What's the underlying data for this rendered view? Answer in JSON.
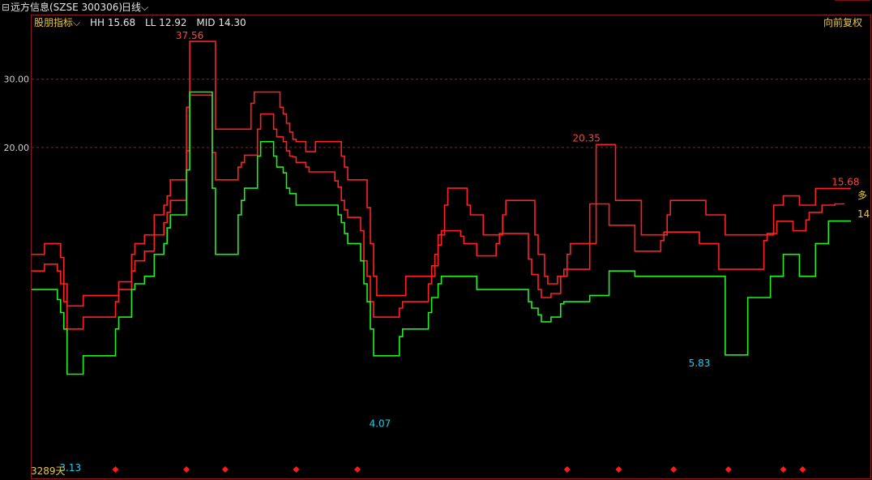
{
  "header": {
    "icon": "minus-box-icon",
    "stock_name": "远方信息(SZSE 300306)",
    "period": "日线",
    "period_icon": "chevron-down-icon"
  },
  "indicator": {
    "name": "股朋指标",
    "name_icon": "chevron-down-icon",
    "hh": "HH 15.68",
    "ll": "LL 12.92",
    "mid": "MID 14.30"
  },
  "adjust_label": "向前复权",
  "colors": {
    "hh": "#ff2020",
    "mid": "#ff2020",
    "ll": "#22ee22",
    "grid": "#a01818",
    "max_label": "#ff4040",
    "min_label": "#22ccee",
    "days_label": "#e8c84a",
    "marker": "#ff1a1a"
  },
  "chart_data": {
    "type": "line",
    "title": "",
    "xlabel": "",
    "ylabel": "",
    "ylim": [
      2.8,
      40
    ],
    "yticks": [
      "30.00",
      "20.00"
    ],
    "ytick_values": [
      30,
      20
    ],
    "grid": "horizontal dashed",
    "x": [
      0,
      1,
      2,
      3,
      4,
      5,
      6,
      7,
      8,
      9,
      10,
      11,
      12,
      13,
      14,
      15,
      16,
      17,
      18,
      19,
      20,
      21,
      22,
      23,
      24,
      25,
      26,
      27,
      28,
      29,
      30,
      31,
      32,
      33,
      34,
      35,
      36,
      37,
      38,
      39,
      40,
      41,
      42,
      43,
      44,
      45,
      46,
      47,
      48,
      49,
      50,
      51,
      52,
      53,
      54,
      55,
      56,
      57,
      58,
      59,
      60,
      61,
      62,
      63,
      64,
      65,
      66,
      67,
      68,
      69,
      70,
      71,
      72,
      73,
      74,
      75,
      76,
      77,
      78,
      79,
      80,
      81,
      82,
      83,
      84,
      85,
      86,
      87,
      88,
      89,
      90,
      91,
      92,
      93,
      94,
      95,
      96,
      97,
      98,
      99,
      100,
      101,
      102,
      103,
      104,
      105,
      106,
      107,
      108,
      109,
      110,
      111,
      112,
      113,
      114,
      115,
      116,
      117,
      118,
      119,
      120,
      121,
      122,
      123,
      124,
      125,
      126,
      127,
      128,
      129,
      130,
      131,
      132,
      133,
      134,
      135,
      136,
      137,
      138,
      139,
      140,
      141,
      142,
      143,
      144,
      145,
      146,
      147,
      148,
      149,
      150,
      151,
      152,
      153,
      154,
      155,
      156,
      157,
      158,
      159,
      160,
      161,
      162,
      163,
      164,
      165,
      166,
      167,
      168,
      169,
      170,
      171,
      172,
      173,
      174,
      175,
      176,
      177,
      178,
      179,
      180,
      181,
      182,
      183,
      184,
      185,
      186,
      187,
      188,
      189,
      190,
      191,
      192,
      193,
      194,
      195,
      196,
      197,
      198,
      199,
      200,
      201,
      202,
      203,
      204,
      205,
      206,
      207,
      208,
      209,
      210,
      211,
      212,
      213,
      214,
      215,
      216,
      217,
      218,
      219,
      220,
      221,
      222,
      223,
      224,
      225,
      226,
      227,
      228,
      229,
      230,
      231,
      232,
      233,
      234,
      235,
      236,
      237,
      238,
      239,
      240,
      241,
      242,
      243,
      244,
      245,
      246,
      247,
      248,
      249,
      250,
      251,
      252,
      253,
      254,
      255,
      256,
      257,
      258,
      259,
      260
    ],
    "series": [
      {
        "key": "hh",
        "values": [
          10.6,
          10.6,
          10.6,
          10.6,
          11.3,
          11.3,
          11.3,
          11.3,
          11.3,
          10.4,
          8.9,
          7.8,
          7.8,
          7.8,
          7.8,
          7.8,
          8.3,
          8.3,
          8.3,
          8.3,
          8.3,
          8.3,
          8.3,
          8.3,
          8.3,
          8.3,
          8.3,
          9.0,
          9.0,
          9.0,
          9.0,
          10.6,
          11.3,
          11.3,
          11.3,
          11.9,
          11.9,
          11.9,
          13.4,
          13.4,
          13.4,
          14.2,
          15.0,
          16.5,
          16.5,
          16.5,
          16.5,
          16.5,
          25.4,
          37.56,
          37.56,
          37.56,
          37.56,
          37.56,
          37.56,
          37.56,
          37.56,
          22.3,
          22.3,
          22.3,
          22.3,
          22.3,
          22.3,
          22.3,
          22.3,
          22.3,
          22.3,
          22.3,
          26.0,
          27.8,
          27.8,
          27.8,
          27.8,
          27.8,
          27.8,
          27.8,
          27.8,
          25.4,
          24.4,
          23.1,
          21.9,
          21.0,
          20.7,
          20.7,
          20.7,
          19.5,
          19.5,
          19.5,
          20.7,
          20.7,
          20.7,
          20.7,
          20.7,
          20.7,
          20.7,
          20.7,
          19.0,
          17.8,
          16.5,
          16.5,
          16.5,
          16.5,
          16.5,
          16.5,
          14.0,
          11.3,
          9.3,
          8.3,
          8.3,
          8.3,
          8.3,
          8.3,
          8.3,
          8.3,
          8.3,
          8.3,
          9.3,
          9.3,
          9.3,
          9.3,
          9.3,
          9.3,
          9.3,
          9.3,
          9.3,
          10.6,
          11.9,
          11.9,
          14.2,
          15.7,
          15.7,
          15.7,
          15.7,
          15.7,
          15.7,
          14.2,
          13.4,
          13.4,
          13.4,
          13.4,
          11.9,
          11.9,
          11.9,
          11.9,
          11.9,
          11.9,
          13.4,
          14.6,
          14.6,
          14.6,
          14.6,
          14.6,
          14.6,
          14.6,
          14.6,
          14.6,
          11.9,
          10.6,
          10.6,
          9.3,
          8.9,
          8.9,
          8.9,
          9.3,
          9.3,
          9.3,
          10.6,
          11.3,
          11.3,
          11.3,
          11.3,
          11.3,
          11.3,
          11.3,
          11.3,
          20.35,
          20.35,
          20.35,
          20.35,
          20.35,
          20.35,
          14.6,
          14.6,
          14.6,
          14.6,
          14.6,
          14.6,
          14.6,
          14.6,
          11.9,
          11.9,
          11.9,
          11.9,
          11.9,
          11.9,
          11.9,
          11.9,
          13.4,
          14.6,
          14.6,
          14.6,
          14.6,
          14.6,
          14.6,
          14.6,
          14.6,
          14.6,
          14.6,
          14.6,
          13.4,
          13.4,
          13.4,
          13.4,
          13.4,
          13.4,
          11.9,
          11.9,
          11.9,
          11.9,
          11.9,
          11.9,
          11.9,
          11.9,
          11.9,
          11.9,
          11.9,
          11.9,
          11.9,
          11.9,
          11.9,
          14.2,
          14.2,
          14.2,
          15.0,
          15.0,
          15.0,
          15.0,
          15.0,
          14.2,
          14.2,
          14.2,
          14.2,
          14.2,
          15.68,
          15.68,
          15.68,
          15.68,
          15.68,
          15.68,
          15.68,
          15.68,
          15.68,
          15.68,
          15.68,
          15.68
        ]
      },
      {
        "key": "mid",
        "values": [
          9.6,
          9.6,
          9.6,
          9.6,
          10.0,
          10.0,
          10.0,
          10.0,
          9.6,
          8.9,
          8.0,
          6.8,
          6.8,
          6.8,
          6.8,
          6.8,
          7.3,
          7.3,
          7.3,
          7.3,
          7.3,
          7.3,
          7.3,
          7.3,
          7.3,
          7.3,
          8.0,
          8.6,
          8.6,
          8.6,
          8.6,
          9.6,
          10.2,
          10.2,
          10.2,
          10.8,
          10.8,
          10.8,
          11.9,
          11.9,
          11.9,
          12.8,
          13.6,
          14.6,
          14.6,
          14.6,
          14.6,
          14.6,
          19.6,
          27.3,
          27.3,
          27.3,
          27.3,
          27.3,
          27.3,
          27.3,
          19.4,
          16.5,
          16.5,
          16.5,
          16.5,
          16.5,
          16.5,
          16.5,
          17.8,
          18.3,
          19.1,
          19.1,
          19.1,
          19.1,
          22.3,
          24.4,
          24.4,
          24.4,
          24.4,
          22.3,
          21.3,
          21.3,
          20.7,
          19.6,
          19.0,
          18.9,
          18.3,
          18.3,
          18.3,
          17.8,
          17.3,
          17.3,
          17.3,
          17.3,
          17.3,
          17.3,
          17.3,
          17.3,
          16.4,
          15.8,
          14.6,
          13.8,
          13.2,
          13.2,
          13.2,
          13.2,
          12.2,
          10.2,
          9.3,
          8.0,
          7.3,
          7.3,
          7.3,
          7.3,
          7.3,
          7.3,
          7.3,
          7.3,
          7.7,
          8.0,
          8.0,
          8.0,
          8.0,
          8.0,
          8.0,
          8.0,
          8.0,
          8.9,
          9.9,
          9.9,
          11.2,
          12.2,
          12.2,
          12.2,
          12.2,
          12.2,
          12.2,
          11.8,
          11.3,
          11.3,
          11.3,
          11.3,
          10.5,
          10.5,
          10.5,
          10.5,
          10.5,
          10.5,
          11.3,
          12.0,
          12.0,
          12.0,
          12.0,
          12.0,
          12.0,
          12.0,
          12.0,
          12.0,
          10.3,
          9.4,
          9.4,
          8.6,
          8.2,
          8.2,
          8.2,
          8.4,
          8.4,
          8.4,
          9.3,
          9.7,
          9.7,
          9.7,
          9.7,
          9.7,
          9.7,
          9.7,
          9.7,
          14.3,
          14.3,
          14.3,
          14.3,
          14.3,
          14.3,
          12.6,
          12.6,
          12.6,
          12.6,
          12.6,
          12.6,
          12.6,
          12.6,
          10.8,
          10.8,
          10.8,
          10.8,
          10.8,
          10.8,
          10.8,
          10.8,
          11.5,
          12.1,
          12.1,
          12.1,
          12.1,
          12.1,
          12.1,
          12.1,
          12.1,
          12.1,
          12.1,
          12.1,
          11.3,
          11.3,
          11.3,
          11.3,
          11.3,
          11.3,
          9.7,
          9.7,
          9.7,
          9.7,
          9.7,
          9.7,
          9.7,
          9.7,
          9.7,
          9.7,
          9.7,
          9.7,
          9.7,
          9.7,
          11.5,
          12.0,
          12.0,
          12.0,
          12.9,
          12.9,
          12.9,
          12.9,
          12.9,
          12.2,
          12.2,
          12.2,
          12.2,
          13.0,
          13.6,
          13.6,
          13.6,
          13.6,
          14.2,
          14.2,
          14.2,
          14.2,
          14.3,
          14.3,
          14.3,
          14.3
        ]
      },
      {
        "key": "ll",
        "values": [
          8.6,
          8.6,
          8.6,
          8.6,
          8.6,
          8.6,
          8.6,
          8.6,
          8.1,
          7.5,
          6.8,
          5.2,
          5.2,
          5.2,
          5.2,
          5.2,
          5.8,
          5.8,
          5.8,
          5.8,
          5.8,
          5.8,
          5.8,
          5.8,
          5.8,
          5.8,
          6.8,
          7.3,
          7.3,
          7.3,
          7.3,
          8.6,
          8.9,
          8.9,
          8.9,
          9.3,
          9.3,
          9.3,
          10.6,
          10.6,
          10.6,
          11.3,
          12.4,
          13.4,
          13.4,
          13.4,
          13.4,
          13.4,
          17.5,
          27.8,
          27.8,
          27.8,
          27.8,
          27.8,
          27.8,
          27.8,
          15.7,
          10.6,
          10.6,
          10.6,
          10.6,
          10.6,
          10.6,
          10.6,
          13.4,
          14.6,
          15.7,
          15.7,
          15.7,
          15.7,
          19.0,
          20.7,
          20.7,
          20.7,
          20.7,
          19.0,
          17.8,
          17.8,
          17.2,
          15.7,
          15.2,
          15.2,
          14.2,
          14.2,
          14.2,
          14.2,
          14.2,
          14.2,
          14.2,
          14.2,
          14.2,
          14.2,
          14.2,
          14.2,
          14.2,
          13.4,
          12.8,
          12.0,
          11.3,
          11.3,
          11.3,
          11.3,
          10.2,
          8.9,
          8.0,
          6.8,
          5.8,
          5.8,
          5.8,
          5.8,
          5.8,
          5.8,
          5.8,
          5.8,
          6.5,
          6.8,
          6.8,
          6.8,
          6.8,
          6.8,
          6.8,
          6.8,
          6.8,
          7.5,
          8.2,
          8.2,
          8.9,
          9.3,
          9.3,
          9.3,
          9.3,
          9.3,
          9.3,
          9.3,
          9.3,
          9.3,
          9.3,
          9.3,
          8.6,
          8.6,
          8.6,
          8.6,
          8.6,
          8.6,
          8.6,
          8.6,
          8.6,
          8.6,
          8.6,
          8.6,
          8.6,
          8.6,
          8.6,
          8.6,
          8.0,
          7.7,
          7.7,
          7.4,
          7.1,
          7.1,
          7.1,
          7.3,
          7.3,
          7.3,
          7.9,
          8.0,
          8.0,
          8.0,
          8.0,
          8.0,
          8.0,
          8.0,
          8.0,
          8.3,
          8.3,
          8.3,
          8.3,
          8.3,
          8.3,
          9.6,
          9.6,
          9.6,
          9.6,
          9.6,
          9.6,
          9.6,
          9.6,
          9.3,
          9.3,
          9.3,
          9.3,
          9.3,
          9.3,
          9.3,
          9.3,
          9.3,
          9.3,
          9.3,
          9.3,
          9.3,
          9.3,
          9.3,
          9.3,
          9.3,
          9.3,
          9.3,
          9.3,
          9.3,
          9.3,
          9.3,
          9.3,
          9.3,
          9.3,
          9.3,
          9.3,
          5.83,
          5.83,
          5.83,
          5.83,
          5.83,
          5.83,
          5.83,
          8.2,
          8.2,
          8.2,
          8.2,
          8.2,
          8.2,
          8.2,
          9.3,
          9.3,
          9.3,
          9.3,
          10.6,
          10.6,
          10.6,
          10.6,
          10.6,
          9.3,
          9.3,
          9.3,
          9.3,
          9.3,
          11.3,
          11.3,
          11.3,
          11.3,
          12.92,
          12.92,
          12.92,
          12.92,
          12.92,
          12.92,
          12.92,
          12.92
        ]
      }
    ],
    "annotations": [
      {
        "label": "37.56",
        "x": 49,
        "y": 37.56,
        "kind": "max"
      },
      {
        "label": "20.35",
        "x": 172,
        "y": 20.35,
        "kind": "max"
      },
      {
        "label": "15.68",
        "x": 250,
        "y": 15.68,
        "kind": "max"
      },
      {
        "label": "3.13",
        "x": 12,
        "y": 3.13,
        "kind": "min"
      },
      {
        "label": "4.07",
        "x": 108,
        "y": 4.07,
        "kind": "min"
      },
      {
        "label": "5.83",
        "x": 207,
        "y": 5.83,
        "kind": "min"
      },
      {
        "label": "14",
        "x": 257,
        "y": 14,
        "kind": "last"
      },
      {
        "label": "多",
        "x": 257,
        "y": 14.6,
        "kind": "signal"
      }
    ],
    "days_label": "3289天",
    "signal_markers_x": [
      26,
      48,
      60,
      82,
      101,
      166,
      182,
      199,
      216,
      233,
      239
    ]
  }
}
